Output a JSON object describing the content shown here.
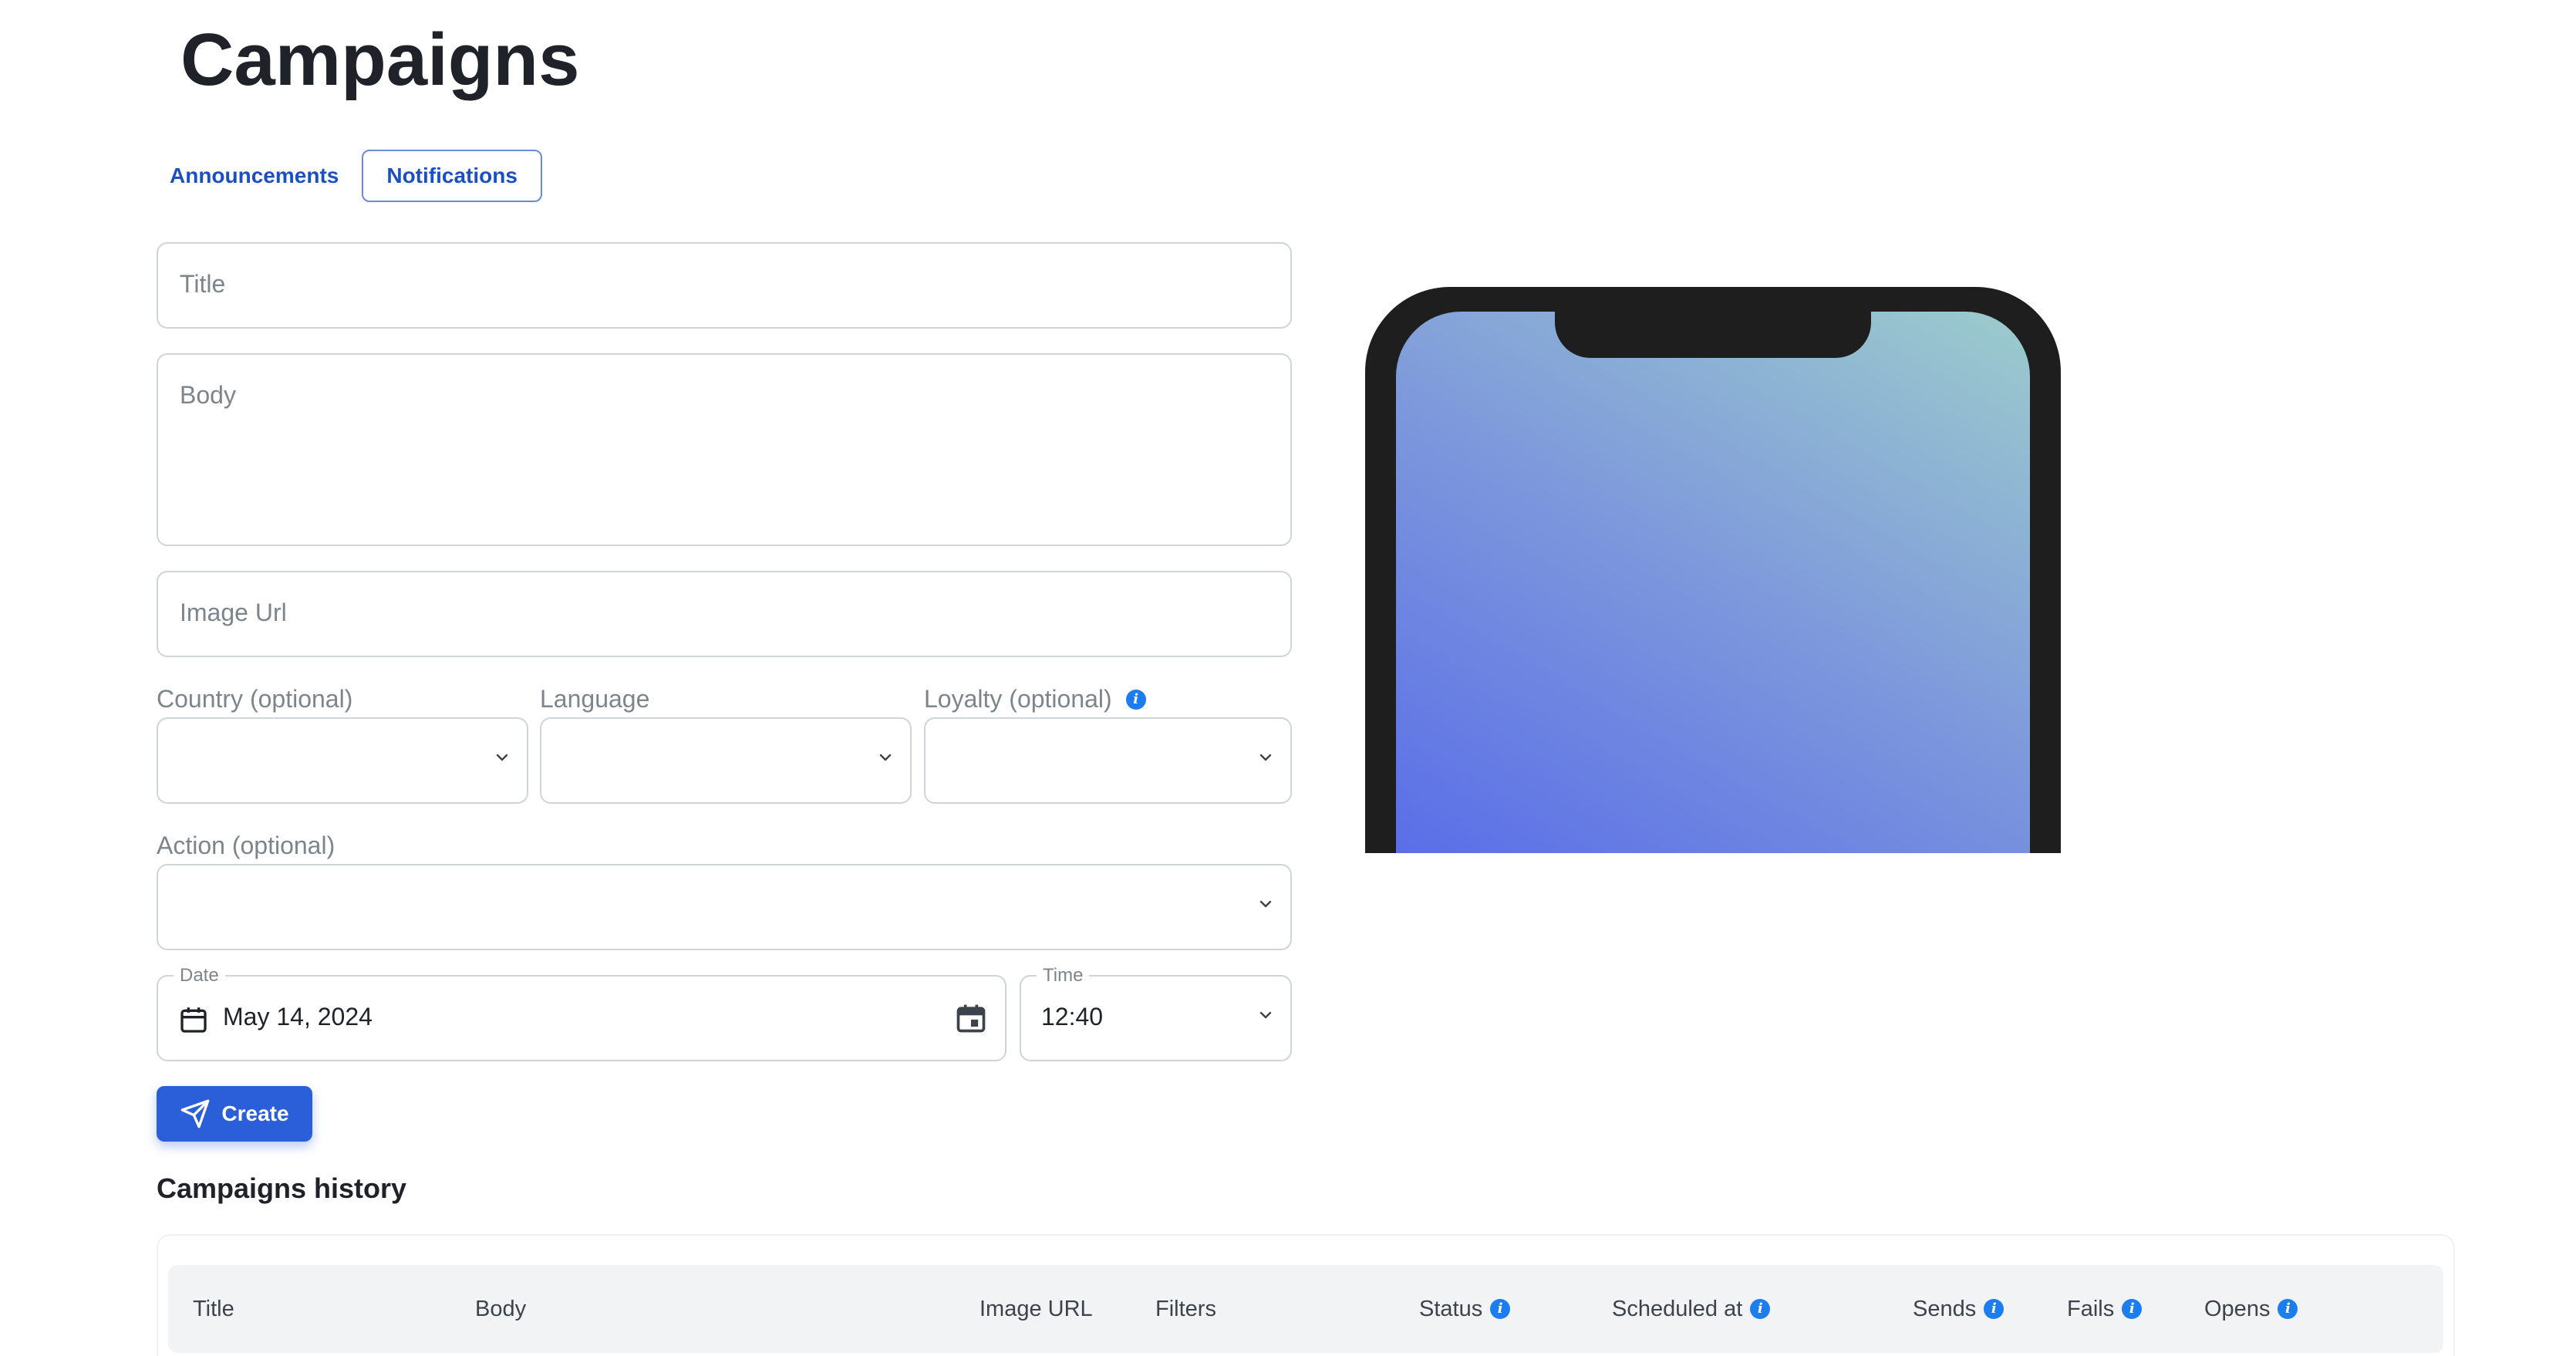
{
  "page": {
    "title": "Campaigns"
  },
  "tabs": [
    {
      "label": "Announcements",
      "active": false
    },
    {
      "label": "Notifications",
      "active": true
    }
  ],
  "form": {
    "title_placeholder": "Title",
    "body_placeholder": "Body",
    "image_url_placeholder": "Image Url",
    "country_label": "Country (optional)",
    "language_label": "Language",
    "loyalty_label": "Loyalty (optional)",
    "action_label": "Action (optional)",
    "date_label": "Date",
    "date_value": "May 14, 2024",
    "time_label": "Time",
    "time_value": "12:40",
    "create_label": "Create"
  },
  "history": {
    "title": "Campaigns history",
    "columns": [
      {
        "label": "Title",
        "info": false
      },
      {
        "label": "Body",
        "info": false
      },
      {
        "label": "Image URL",
        "info": false
      },
      {
        "label": "Filters",
        "info": false
      },
      {
        "label": "Status",
        "info": true
      },
      {
        "label": "Scheduled at",
        "info": true
      },
      {
        "label": "Sends",
        "info": true
      },
      {
        "label": "Fails",
        "info": true
      },
      {
        "label": "Opens",
        "info": true
      }
    ]
  },
  "colors": {
    "accent": "#2b5fd9",
    "info": "#1b7df0",
    "phone_frame": "#1e1e1e"
  },
  "icons": {
    "info": "info-icon",
    "chevron": "chevron-down-icon",
    "calendar": "calendar-icon",
    "send": "send-icon"
  }
}
